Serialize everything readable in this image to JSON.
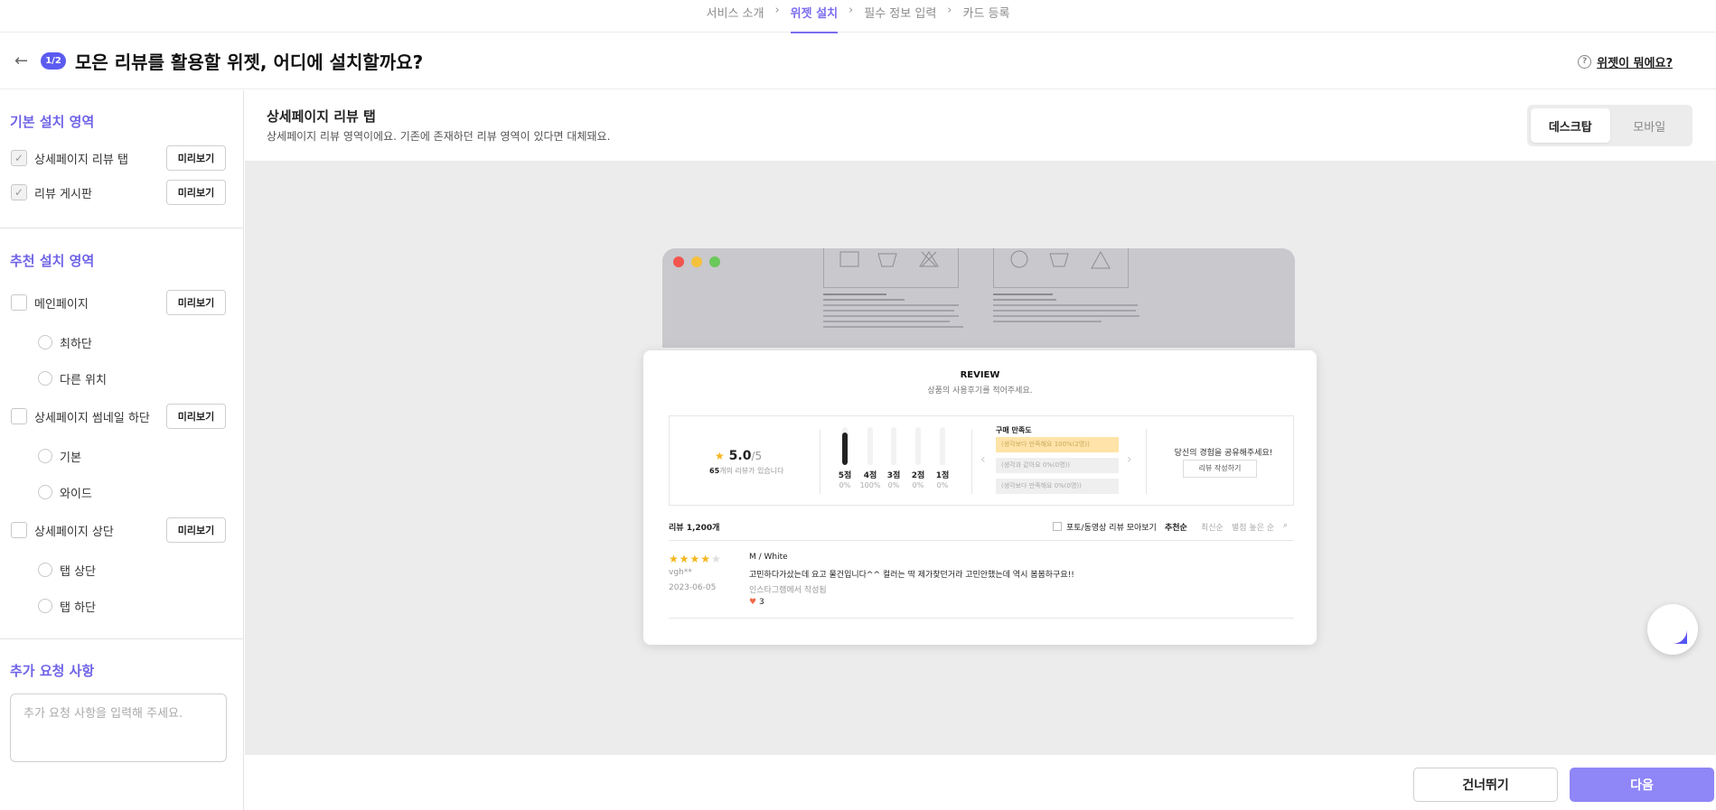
{
  "stepper": {
    "steps": [
      {
        "label": "서비스 소개",
        "active": false
      },
      {
        "label": "위젯 설치",
        "active": true
      },
      {
        "label": "필수 정보 입력",
        "active": false
      },
      {
        "label": "카드 등록",
        "active": false
      }
    ]
  },
  "header": {
    "step_badge": "1/2",
    "title": "모은 리뷰를 활용할 위젯, 어디에 설치할까요?",
    "help_link": "위젯이 뭐에요?"
  },
  "sidebar": {
    "basic_title": "기본 설치 영역",
    "basic_items": [
      {
        "label": "상세페이지 리뷰 탭",
        "checked": true,
        "preview": "미리보기"
      },
      {
        "label": "리뷰 게시판",
        "checked": true,
        "preview": "미리보기"
      }
    ],
    "recommend_title": "추천 설치 영역",
    "recommend_items": [
      {
        "label": "메인페이지",
        "checked": false,
        "preview": "미리보기",
        "options": [
          "최하단",
          "다른 위치"
        ]
      },
      {
        "label": "상세페이지 썸네일 하단",
        "checked": false,
        "preview": "미리보기",
        "options": [
          "기본",
          "와이드"
        ]
      },
      {
        "label": "상세페이지 상단",
        "checked": false,
        "preview": "미리보기",
        "options": [
          "탭 상단",
          "탭 하단"
        ]
      }
    ],
    "extra_title": "추가 요청 사항",
    "extra_placeholder": "추가 요청 사항을 입력해 주세요."
  },
  "main": {
    "title": "상세페이지 리뷰 탭",
    "subtitle": "상세페이지 리뷰 영역이에요. 기존에 존재하던 리뷰 영역이 있다면 대체돼요.",
    "toggle": [
      {
        "label": "데스크탑",
        "active": true
      },
      {
        "label": "모바일",
        "active": false
      }
    ]
  },
  "review_widget": {
    "title": "REVIEW",
    "subtitle": "상품의 사용후기를 적어주세요.",
    "score": "5.0",
    "score_max": "/5",
    "count_num": "65",
    "count_text": "개의 리뷰가 있습니다",
    "bars": [
      {
        "label": "5점",
        "pct": "0%",
        "fill": 0.85
      },
      {
        "label": "4점",
        "pct": "100%",
        "fill": 0.0
      },
      {
        "label": "3점",
        "pct": "0%",
        "fill": 0.0
      },
      {
        "label": "2점",
        "pct": "0%",
        "fill": 0.0
      },
      {
        "label": "1점",
        "pct": "0%",
        "fill": 0.0
      }
    ],
    "satisfaction_title": "구매 만족도",
    "satisfaction": [
      "(생각보다 만족해요 100%(2명))",
      "(생각과 같아요 0%(0명))",
      "(생각보다 만족해요 0%(0명))"
    ],
    "share_title": "당신의 경험을 공유해주세요!",
    "share_button": "리뷰 작성하기",
    "review_count": "리뷰 1,200개",
    "filter_label": "포토/동영상 리뷰 모아보기",
    "sort_options": [
      "추천순",
      "최신순",
      "별점 높은 순"
    ],
    "review": {
      "rating": 4,
      "option": "M / White",
      "user": "vgh**",
      "date": "2023-06-05",
      "text": "고민하다가샀는데 요고 물건입니다^^ 컬러는 딱 제가찾던거라 고민안했는데 역시 봄봄하구요!!",
      "source": "인스타그램에서 작성됨",
      "likes": "3"
    }
  },
  "footer": {
    "skip": "건너뛰기",
    "next": "다음"
  },
  "colors": {
    "accent": "#7b6cf0",
    "next_button": "#8f86f7",
    "badge": "#5b5bf0",
    "star": "#f5b51b"
  }
}
